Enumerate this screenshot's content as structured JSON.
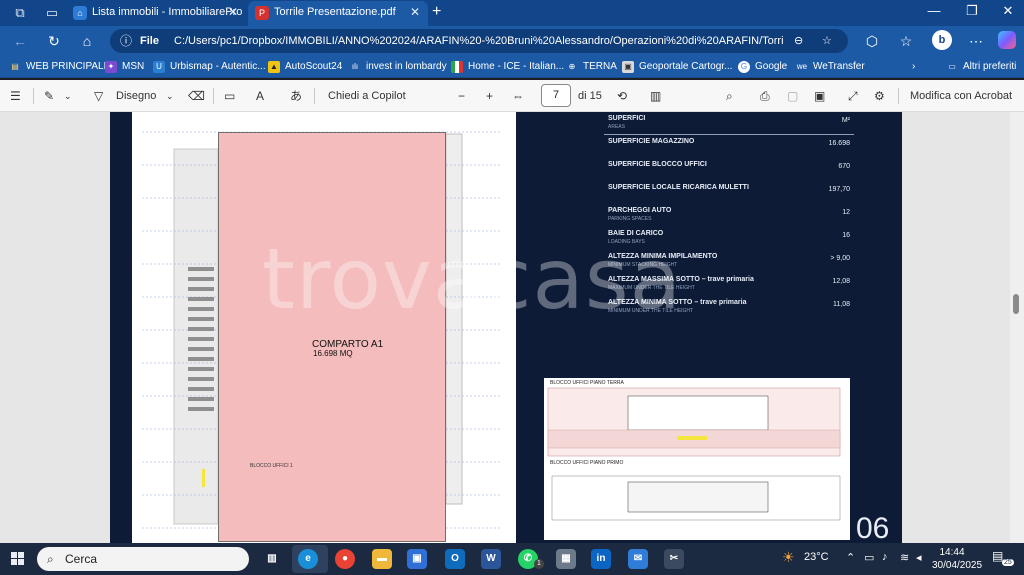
{
  "browser": {
    "tabs": [
      {
        "title": "Lista immobili - ImmobiliarePro",
        "active": false
      },
      {
        "title": "Torrile Presentazione.pdf",
        "active": true
      }
    ],
    "address": {
      "scheme": "File",
      "url": "C:/Users/pc1/Dropbox/IMMOBILI/ANNO%202024/ARAFIN%20-%20Bruni%20Alessandro/Operazioni%20di%20ARAFIN/Torrile/Tor..."
    },
    "bookmarks": [
      "WEB PRINCIPALE",
      "MSN",
      "Urbismap - Autentic...",
      "AutoScout24",
      "invest in lombardy",
      "Home - ICE - Italian...",
      "TERNA",
      "Geoportale Cartogr...",
      "Google",
      "WeTransfer"
    ],
    "bookmarks_more": "Altri preferiti",
    "profile_initial": "b"
  },
  "pdf_toolbar": {
    "draw_label": "Disegno",
    "copilot_label": "Chiedi a Copilot",
    "page_current": "7",
    "page_total": "di 15",
    "acrobat_label": "Modifica con Acrobat"
  },
  "document": {
    "plan_label": "COMPARTO A1",
    "plan_area": "16.698 MQ",
    "plan_office_label": "BLOCCO UFFICI 1",
    "watermark": "trovacasa",
    "specs_header": {
      "title": "SUPERFICI",
      "subtitle": "AREAS",
      "unit": "M²"
    },
    "specs": [
      {
        "label": "SUPERFICIE MAGAZZINO",
        "sub": "",
        "value": "16.698"
      },
      {
        "label": "SUPERFICIE BLOCCO UFFICI",
        "sub": "",
        "value": "670"
      },
      {
        "label": "SUPERFICIE LOCALE RICARICA MULETTI",
        "sub": "",
        "value": "197,70"
      },
      {
        "label": "PARCHEGGI AUTO",
        "sub": "PARKING SPACES",
        "value": "12"
      },
      {
        "label": "BAIE DI CARICO",
        "sub": "LOADING BAYS",
        "value": "16"
      },
      {
        "label": "ALTEZZA MINIMA IMPILAMENTO",
        "sub": "MINIMUM STACKING HEIGHT",
        "value": "> 9,00"
      },
      {
        "label": "ALTEZZA MASSIMA SOTTO – trave primaria",
        "sub": "MAXIMUM UNDER THE TILE HEIGHT",
        "value": "12,08"
      },
      {
        "label": "ALTEZZA MINIMA SOTTO – trave primaria",
        "sub": "MINIMUM UNDER THE TILE HEIGHT",
        "value": "11,08"
      }
    ],
    "thumb_title_1": "BLOCCO UFFICI  PIANO TERRA",
    "thumb_title_2": "BLOCCO UFFICI  PIANO PRIMO",
    "page_number": "06"
  },
  "taskbar": {
    "search_placeholder": "Cerca",
    "temperature": "23°C",
    "time": "14:44",
    "date": "30/04/2025",
    "notifications": "25",
    "whatsapp_badge": "1"
  }
}
